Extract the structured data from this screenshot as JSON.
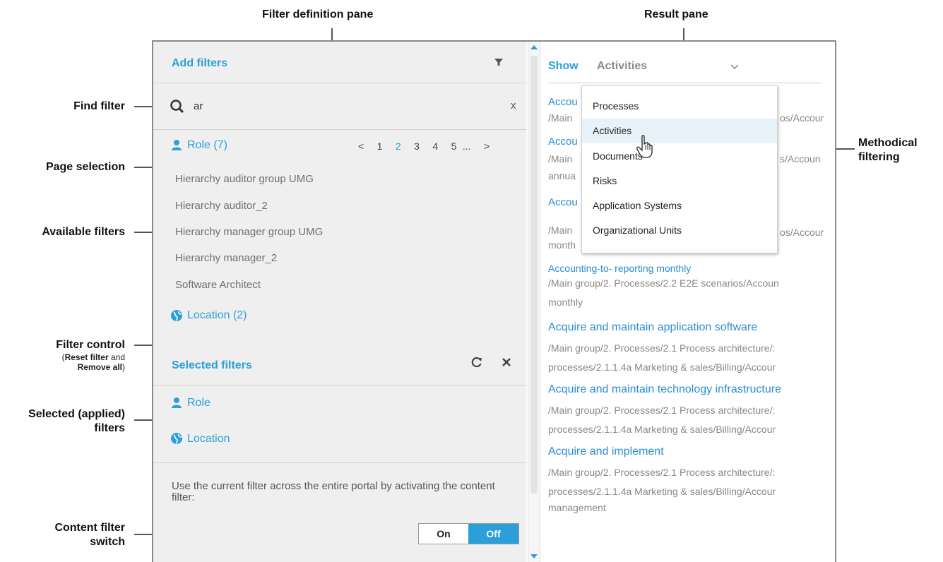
{
  "annotations": {
    "filter_definition_pane": "Filter definition pane",
    "result_pane": "Result pane",
    "find_filter": "Find filter",
    "page_selection": "Page selection",
    "available_filters": "Available filters",
    "filter_control": "Filter control",
    "filter_control_sub_reset": "Reset filter",
    "filter_control_sub_and": "and",
    "filter_control_sub_remove": "Remove all",
    "selected_applied_line1": "Selected (applied)",
    "selected_applied_line2": "filters",
    "content_filter_line1": "Content filter",
    "content_filter_line2": "switch",
    "methodical_line1": "Methodical",
    "methodical_line2": "filtering"
  },
  "left_pane": {
    "add_filters_title": "Add filters",
    "search_value": "ar",
    "clear_label": "x",
    "role_group": "Role (7)",
    "pager": {
      "prev": "<",
      "pages": [
        "1",
        "2",
        "3",
        "4",
        "5"
      ],
      "current": "2",
      "ellipsis": "...",
      "next": ">"
    },
    "items": [
      "Hierarchy auditor group UMG",
      "Hierarchy auditor_2",
      "Hierarchy manager group UMG",
      "Hierarchy manager_2",
      "Software Architect"
    ],
    "location_group": "Location (2)",
    "selected_filters_title": "Selected filters",
    "selected_items": [
      "Role",
      "Location"
    ],
    "content_text": "Use the current filter across the entire portal by activating the content filter:",
    "toggle_on": "On",
    "toggle_off": "Off"
  },
  "right_pane": {
    "show_label": "Show",
    "show_value": "Activities",
    "menu_items": [
      "Processes",
      "Activities",
      "Documents",
      "Risks",
      "Application Systems",
      "Organizational Units"
    ],
    "menu_selected": "Activities",
    "partial_results": [
      {
        "title": "Accou",
        "path": "/Main",
        "path_tail": "os/Accour"
      },
      {
        "title": "Accou",
        "path": "/Main",
        "path_tail": "s/Accoun",
        "extra": "annua"
      },
      {
        "title": "Accou",
        "path": "/Main",
        "path_tail": "os/Accour",
        "extra": "month"
      }
    ],
    "results": [
      {
        "title": "Accounting-to- reporting monthly",
        "lines": [
          "/Main group/2. Processes/2.2 E2E scenarios/Accoun",
          "monthly"
        ]
      },
      {
        "title": "Acquire and maintain application software",
        "lines": [
          "/Main group/2. Processes/2.1 Process architecture/:",
          "processes/2.1.1.4a Marketing & sales/Billing/Accour"
        ]
      },
      {
        "title": "Acquire and maintain technology infrastructure",
        "lines": [
          "/Main group/2. Processes/2.1 Process architecture/:",
          "processes/2.1.1.4a Marketing & sales/Billing/Accour"
        ]
      },
      {
        "title": "Acquire and implement",
        "lines": [
          "/Main group/2. Processes/2.1 Process architecture/:",
          "processes/2.1.1.4a Marketing & sales/Billing/Accour",
          "management"
        ]
      }
    ]
  },
  "colors": {
    "accent": "#2b9fd9",
    "pane_bg": "#efefef",
    "annotation_arrow": "#555555"
  }
}
